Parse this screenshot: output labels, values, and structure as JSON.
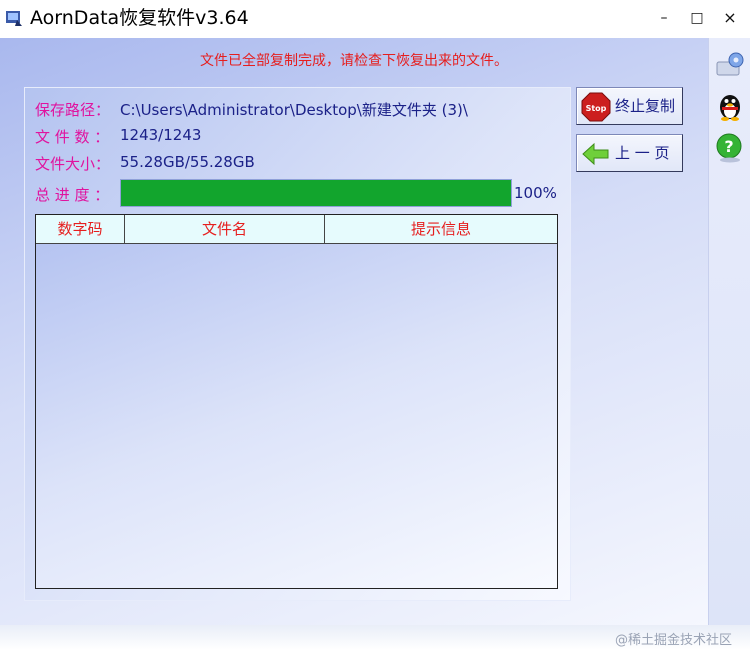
{
  "window": {
    "title": "AornData恢复软件v3.64",
    "controls": {
      "minimize": "–",
      "maximize": "□",
      "close": "×"
    }
  },
  "status_message": "文件已全部复制完成，请检查下恢复出来的文件。",
  "info": {
    "save_path_label": "保存路径：",
    "save_path_value": "C:\\Users\\Administrator\\Desktop\\新建文件夹 (3)\\",
    "file_count_label": "文 件 数 ：",
    "file_count_value": "1243/1243",
    "file_size_label": "文件大小：",
    "file_size_value": "55.28GB/55.28GB",
    "progress_label": "总 进 度 ：",
    "progress_percent": 100,
    "progress_text": "100%"
  },
  "table": {
    "columns": [
      "数字码",
      "文件名",
      "提示信息"
    ],
    "rows": []
  },
  "buttons": {
    "stop_label": "终止复制",
    "stop_icon_text": "Stop",
    "prev_label": "上 一 页"
  },
  "sidebar": {
    "icons": [
      "settings-icon",
      "qq-penguin-icon",
      "help-icon"
    ],
    "help_glyph": "?"
  },
  "watermark": "@稀土掘金技术社区",
  "colors": {
    "accent_red": "#e61e1e",
    "label_magenta": "#e0139f",
    "value_blue": "#1b2188",
    "progress_green": "#12a52d"
  }
}
